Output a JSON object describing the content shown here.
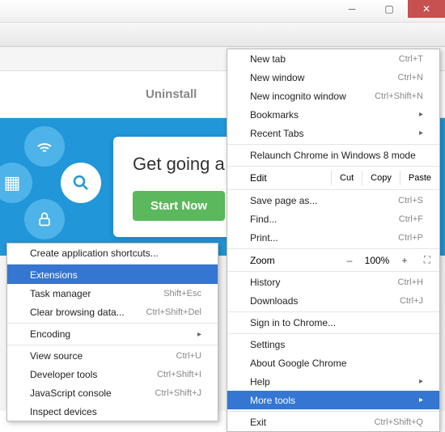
{
  "page": {
    "uninstall": "Uninstall",
    "headline": "Get going a goinggo",
    "startNow": "Start Now"
  },
  "mainMenu": {
    "newTab": {
      "l": "New tab",
      "s": "Ctrl+T"
    },
    "newWindow": {
      "l": "New window",
      "s": "Ctrl+N"
    },
    "newIncognito": {
      "l": "New incognito window",
      "s": "Ctrl+Shift+N"
    },
    "bookmarks": {
      "l": "Bookmarks"
    },
    "recentTabs": {
      "l": "Recent Tabs"
    },
    "relaunch": {
      "l": "Relaunch Chrome in Windows 8 mode"
    },
    "edit": {
      "l": "Edit",
      "cut": "Cut",
      "copy": "Copy",
      "paste": "Paste"
    },
    "savePage": {
      "l": "Save page as...",
      "s": "Ctrl+S"
    },
    "find": {
      "l": "Find...",
      "s": "Ctrl+F"
    },
    "print": {
      "l": "Print...",
      "s": "Ctrl+P"
    },
    "zoom": {
      "l": "Zoom",
      "v": "100%"
    },
    "history": {
      "l": "History",
      "s": "Ctrl+H"
    },
    "downloads": {
      "l": "Downloads",
      "s": "Ctrl+J"
    },
    "signIn": {
      "l": "Sign in to Chrome..."
    },
    "settings": {
      "l": "Settings"
    },
    "about": {
      "l": "About Google Chrome"
    },
    "help": {
      "l": "Help"
    },
    "moreTools": {
      "l": "More tools"
    },
    "exit": {
      "l": "Exit",
      "s": "Ctrl+Shift+Q"
    }
  },
  "subMenu": {
    "createShortcuts": {
      "l": "Create application shortcuts..."
    },
    "extensions": {
      "l": "Extensions"
    },
    "taskManager": {
      "l": "Task manager",
      "s": "Shift+Esc"
    },
    "clearBrowsing": {
      "l": "Clear browsing data...",
      "s": "Ctrl+Shift+Del"
    },
    "encoding": {
      "l": "Encoding"
    },
    "viewSource": {
      "l": "View source",
      "s": "Ctrl+U"
    },
    "devTools": {
      "l": "Developer tools",
      "s": "Ctrl+Shift+I"
    },
    "jsConsole": {
      "l": "JavaScript console",
      "s": "Ctrl+Shift+J"
    },
    "inspect": {
      "l": "Inspect devices"
    }
  }
}
